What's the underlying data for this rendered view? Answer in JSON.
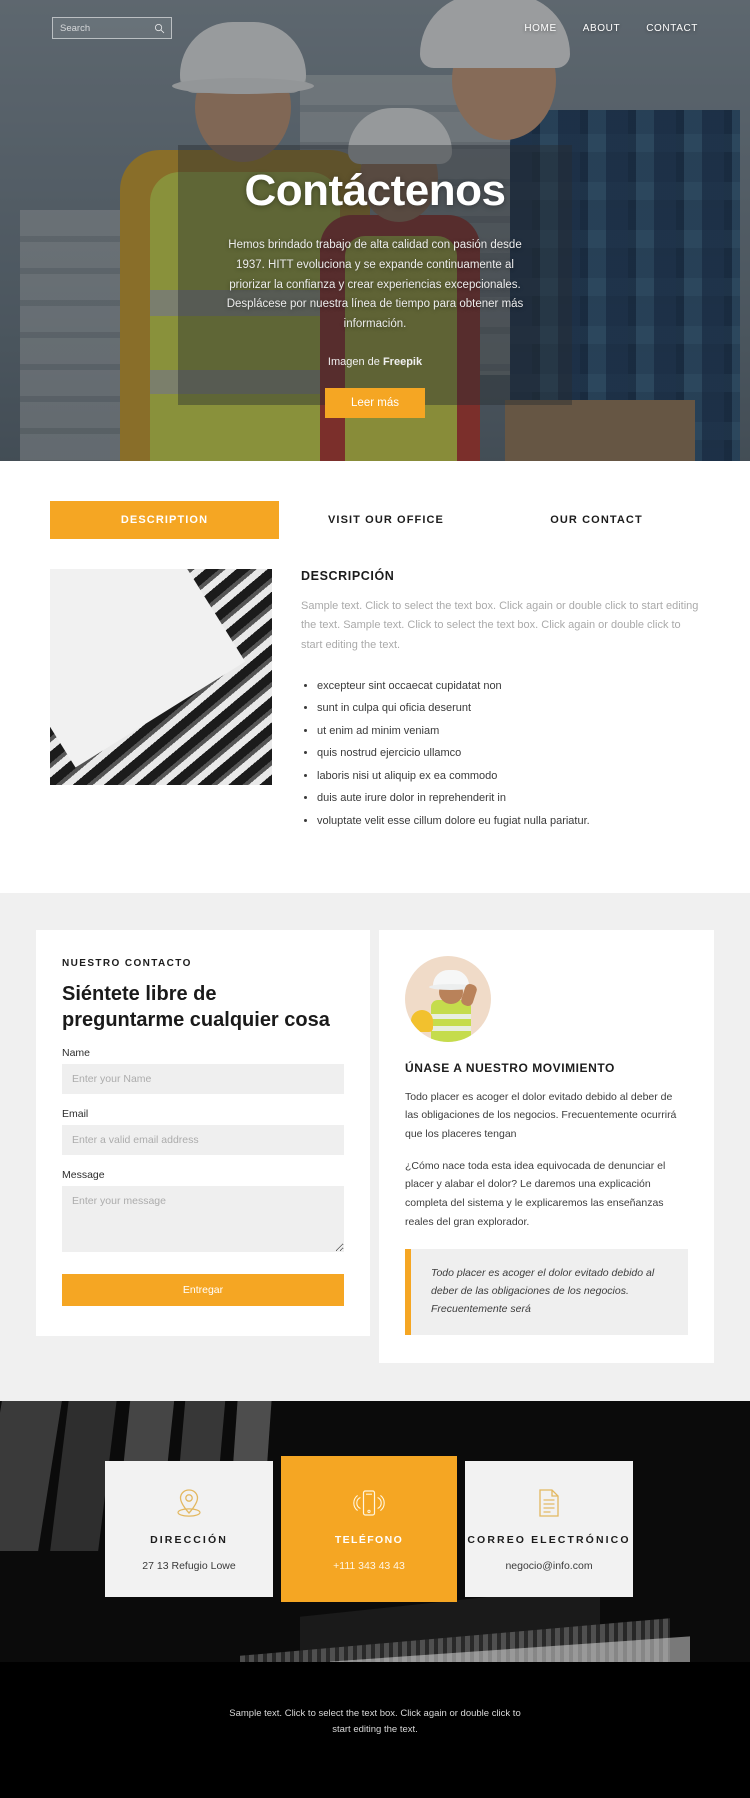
{
  "topbar": {
    "search": {
      "placeholder": "Search",
      "value": "",
      "icon": "search-icon"
    },
    "nav": [
      {
        "label": "HOME"
      },
      {
        "label": "ABOUT"
      },
      {
        "label": "CONTACT"
      }
    ]
  },
  "hero": {
    "title": "Contáctenos",
    "subtitle": "Hemos brindado trabajo de alta calidad con pasión desde 1937. HITT evoluciona y se expande continuamente al priorizar la confianza y crear experiencias excepcionales. Desplácese por nuestra línea de tiempo para obtener más información.",
    "credit_prefix": "Imagen de ",
    "credit_source": "Freepik",
    "button": "Leer más"
  },
  "tabs": {
    "items": [
      {
        "label": "DESCRIPTION",
        "active": true
      },
      {
        "label": "VISIT OUR OFFICE",
        "active": false
      },
      {
        "label": "OUR CONTACT",
        "active": false
      }
    ],
    "panel": {
      "heading": "DESCRIPCIÓN",
      "paragraph": "Sample text. Click to select the text box. Click again or double click to start editing the text. Sample text. Click to select the text box. Click again or double click to start editing the text.",
      "bullets": [
        "excepteur sint occaecat cupidatat non",
        "sunt in culpa qui oficia deserunt",
        "ut enim ad minim veniam",
        "quis nostrud ejercicio ullamco",
        "laboris nisi ut aliquip ex ea commodo",
        "duis aute irure dolor in reprehenderit in",
        "voluptate velit esse cillum dolore eu fugiat nulla pariatur."
      ]
    }
  },
  "contact_form": {
    "eyebrow": "NUESTRO CONTACTO",
    "title": "Siéntete libre de preguntarme cualquier cosa",
    "fields": [
      {
        "label": "Name",
        "placeholder": "Enter your Name",
        "value": ""
      },
      {
        "label": "Email",
        "placeholder": "Enter a valid email address",
        "value": ""
      },
      {
        "label": "Message",
        "placeholder": "Enter your message",
        "value": ""
      }
    ],
    "submit": "Entregar"
  },
  "side_card": {
    "avatar_icon": "worker-avatar",
    "heading": "ÚNASE A NUESTRO MOVIMIENTO",
    "paragraph1": "Todo placer es acoger el dolor evitado debido al deber de las obligaciones de los negocios. Frecuentemente ocurrirá que los placeres tengan",
    "paragraph2": "¿Cómo nace toda esta idea equivocada de denunciar el placer y alabar el dolor? Le daremos una explicación completa del sistema y le explicaremos las enseñanzas reales del gran explorador.",
    "quote": "Todo placer es acoger el dolor evitado debido al deber de las obligaciones de los negocios. Frecuentemente será"
  },
  "contact_cards": [
    {
      "icon": "location-pin-icon",
      "title": "DIRECCIÓN",
      "value": "27 13 Refugio Lowe",
      "active": false
    },
    {
      "icon": "mobile-phone-icon",
      "title": "TELÉFONO",
      "value": "+111 343 43 43",
      "active": true
    },
    {
      "icon": "document-icon",
      "title": "CORREO ELECTRÓNICO",
      "value": "negocio@info.com",
      "active": false
    }
  ],
  "footer": {
    "text": "Sample text. Click to select the text box. Click again or double click to start editing the text."
  },
  "colors": {
    "accent": "#f5a623",
    "dark": "#000000",
    "light_gray": "#f0f0f0",
    "field_gray": "#efefef"
  }
}
